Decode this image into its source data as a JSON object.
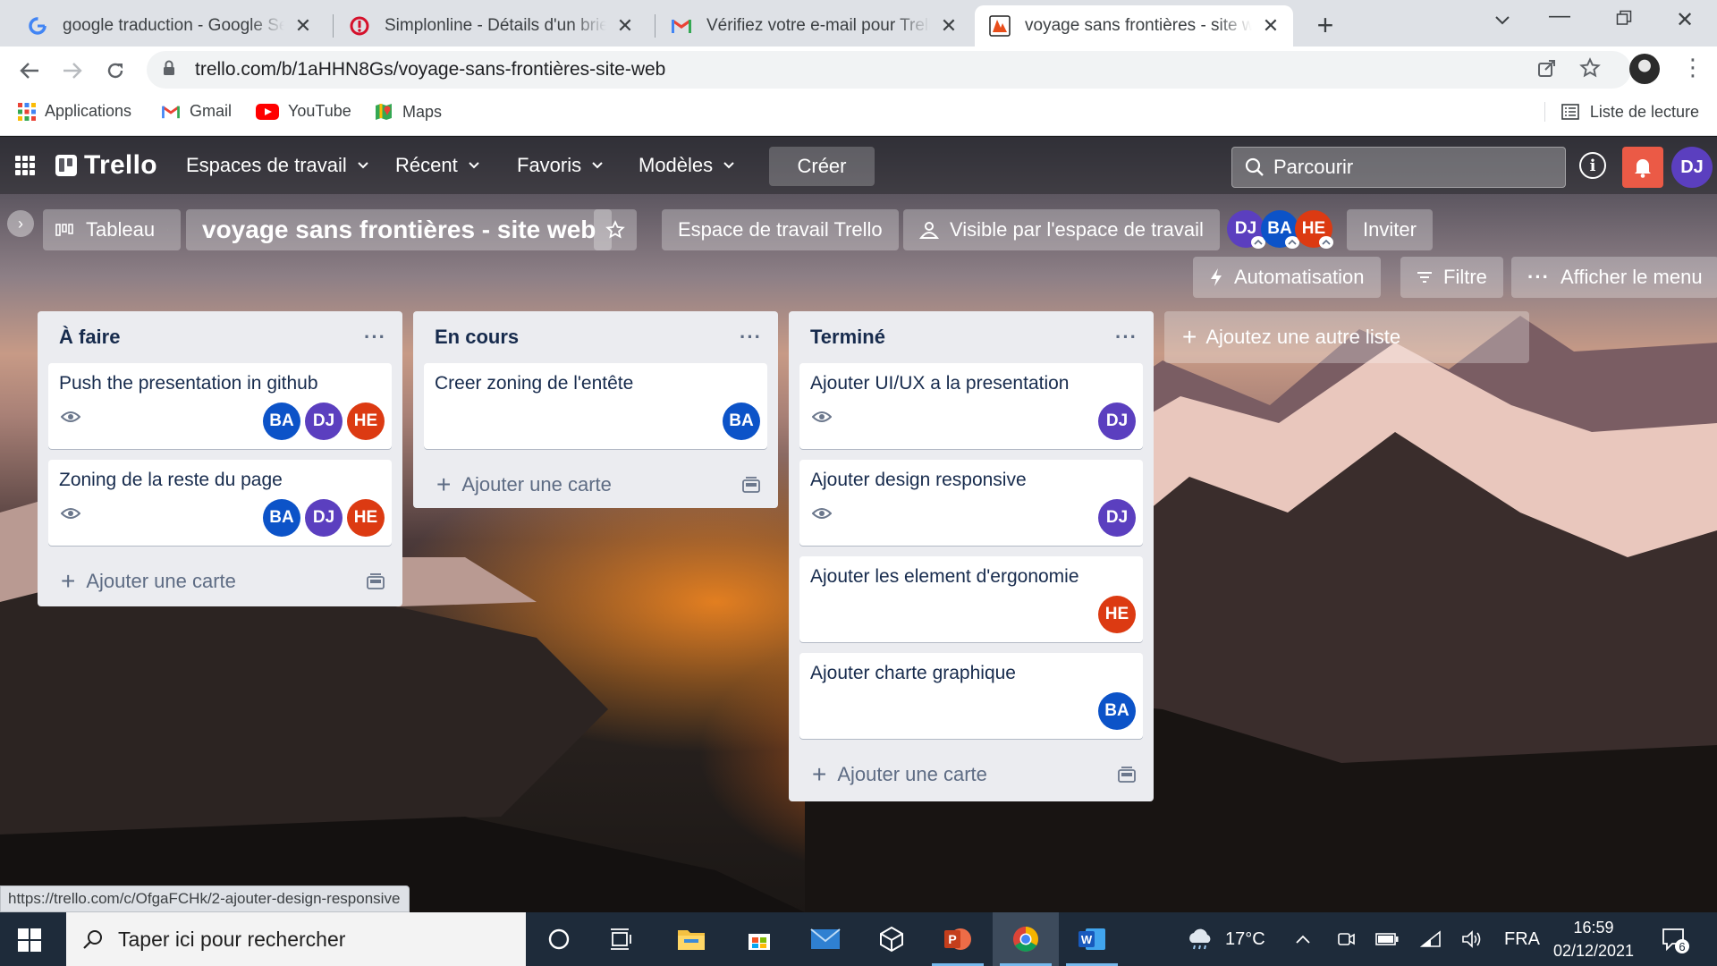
{
  "browser": {
    "tabs": [
      {
        "title": "google traduction - Google Search",
        "favicon": "google-favicon"
      },
      {
        "title": "Simplonline - Détails d'un brief",
        "favicon": "simplonline-favicon"
      },
      {
        "title": "Vérifiez votre e-mail pour Trello - ",
        "favicon": "gmail-favicon"
      },
      {
        "title": "voyage sans frontières - site web",
        "favicon": "trello-favicon",
        "active": true
      }
    ],
    "url": "trello.com/b/1aHHN8Gs/voyage-sans-frontières-site-web",
    "bookmarks": [
      {
        "label": "Applications",
        "icon": "apps-grid-icon"
      },
      {
        "label": "Gmail",
        "icon": "gmail-icon"
      },
      {
        "label": "YouTube",
        "icon": "youtube-icon"
      },
      {
        "label": "Maps",
        "icon": "maps-icon"
      }
    ],
    "reading_list": "Liste de lecture",
    "status_url": "https://trello.com/c/OfgaFCHk/2-ajouter-design-responsive"
  },
  "trello": {
    "logo": "Trello",
    "nav": [
      {
        "label": "Espaces de travail"
      },
      {
        "label": "Récent"
      },
      {
        "label": "Favoris"
      },
      {
        "label": "Modèles"
      }
    ],
    "create": "Créer",
    "search_placeholder": "Parcourir",
    "me_initials": "DJ",
    "board": {
      "view": "Tableau",
      "title": "voyage sans frontières - site web",
      "workspace": "Espace de travail Trello",
      "visibility": "Visible par l'espace de travail",
      "members": [
        {
          "initials": "DJ",
          "color": "#5b3fbf"
        },
        {
          "initials": "BA",
          "color": "#0c53c8"
        },
        {
          "initials": "HE",
          "color": "#dc3a12"
        }
      ],
      "invite": "Inviter",
      "automation": "Automatisation",
      "filter": "Filtre",
      "menu": "Afficher le menu",
      "add_list": "Ajoutez une autre liste"
    },
    "add_card": "Ajouter une carte",
    "lists": [
      {
        "title": "À faire",
        "cards": [
          {
            "title": "Push the presentation in github",
            "watch": true,
            "members": [
              "BA",
              "DJ",
              "HE"
            ]
          },
          {
            "title": "Zoning de la reste du page",
            "watch": true,
            "members": [
              "BA",
              "DJ",
              "HE"
            ]
          }
        ]
      },
      {
        "title": "En cours",
        "cards": [
          {
            "title": "Creer zoning de l'entête",
            "watch": false,
            "members": [
              "BA"
            ]
          }
        ]
      },
      {
        "title": "Terminé",
        "cards": [
          {
            "title": "Ajouter UI/UX a la presentation",
            "watch": true,
            "members": [
              "DJ"
            ]
          },
          {
            "title": "Ajouter design responsive",
            "watch": true,
            "members": [
              "DJ"
            ]
          },
          {
            "title": "Ajouter les element d'ergonomie",
            "watch": false,
            "members": [
              "HE"
            ]
          },
          {
            "title": "Ajouter charte graphique",
            "watch": false,
            "members": [
              "BA"
            ]
          }
        ]
      }
    ],
    "member_colors": {
      "BA": "#0c53c8",
      "DJ": "#5b3fbf",
      "HE": "#dc3a12"
    }
  },
  "taskbar": {
    "search_placeholder": "Taper ici pour rechercher",
    "weather": "17°C",
    "language": "FRA",
    "time": "16:59",
    "date": "02/12/2021",
    "notifications": "6"
  }
}
